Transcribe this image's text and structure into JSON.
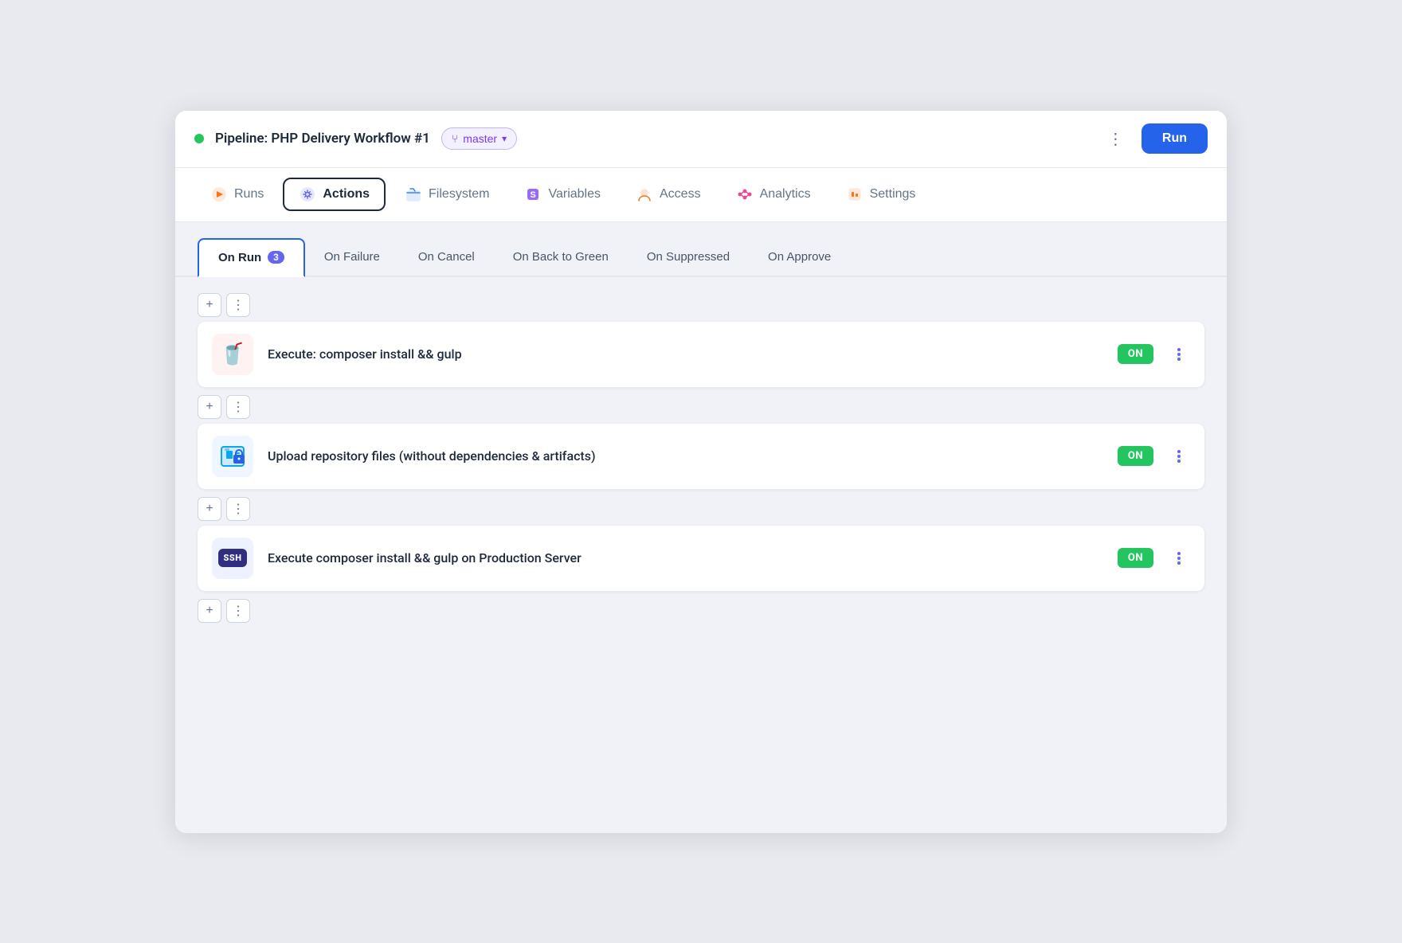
{
  "header": {
    "status": "green",
    "pipeline_title": "Pipeline: PHP Delivery Workflow #1",
    "branch_label": "master",
    "more_label": "⋮",
    "run_label": "Run"
  },
  "nav_tabs": [
    {
      "id": "runs",
      "label": "Runs",
      "icon": "runs-icon",
      "active": false
    },
    {
      "id": "actions",
      "label": "Actions",
      "icon": "actions-icon",
      "active": true
    },
    {
      "id": "filesystem",
      "label": "Filesystem",
      "icon": "filesystem-icon",
      "active": false
    },
    {
      "id": "variables",
      "label": "Variables",
      "icon": "variables-icon",
      "active": false
    },
    {
      "id": "access",
      "label": "Access",
      "icon": "access-icon",
      "active": false
    },
    {
      "id": "analytics",
      "label": "Analytics",
      "icon": "analytics-icon",
      "active": false
    },
    {
      "id": "settings",
      "label": "Settings",
      "icon": "settings-icon",
      "active": false
    }
  ],
  "sub_tabs": [
    {
      "id": "on-run",
      "label": "On Run",
      "badge": "3",
      "active": true
    },
    {
      "id": "on-failure",
      "label": "On Failure",
      "badge": null,
      "active": false
    },
    {
      "id": "on-cancel",
      "label": "On Cancel",
      "badge": null,
      "active": false
    },
    {
      "id": "on-back-to-green",
      "label": "On Back to Green",
      "badge": null,
      "active": false
    },
    {
      "id": "on-suppressed",
      "label": "On Suppressed",
      "badge": null,
      "active": false
    },
    {
      "id": "on-approve",
      "label": "On Approve",
      "badge": null,
      "active": false
    }
  ],
  "actions": [
    {
      "id": "action-1",
      "icon_type": "drink",
      "icon_emoji": "🥤",
      "icon_class": "red-bg",
      "title": "Execute: composer install && gulp",
      "status": "ON"
    },
    {
      "id": "action-2",
      "icon_type": "upload",
      "icon_emoji": "🔒",
      "icon_class": "blue-bg",
      "title": "Upload repository files (without dependencies & artifacts)",
      "status": "ON"
    },
    {
      "id": "action-3",
      "icon_type": "ssh",
      "icon_emoji": "SSH",
      "icon_class": "indigo-bg",
      "title": "Execute composer install && gulp on Production Server",
      "status": "ON"
    }
  ],
  "add_label": "+",
  "on_label": "ON"
}
